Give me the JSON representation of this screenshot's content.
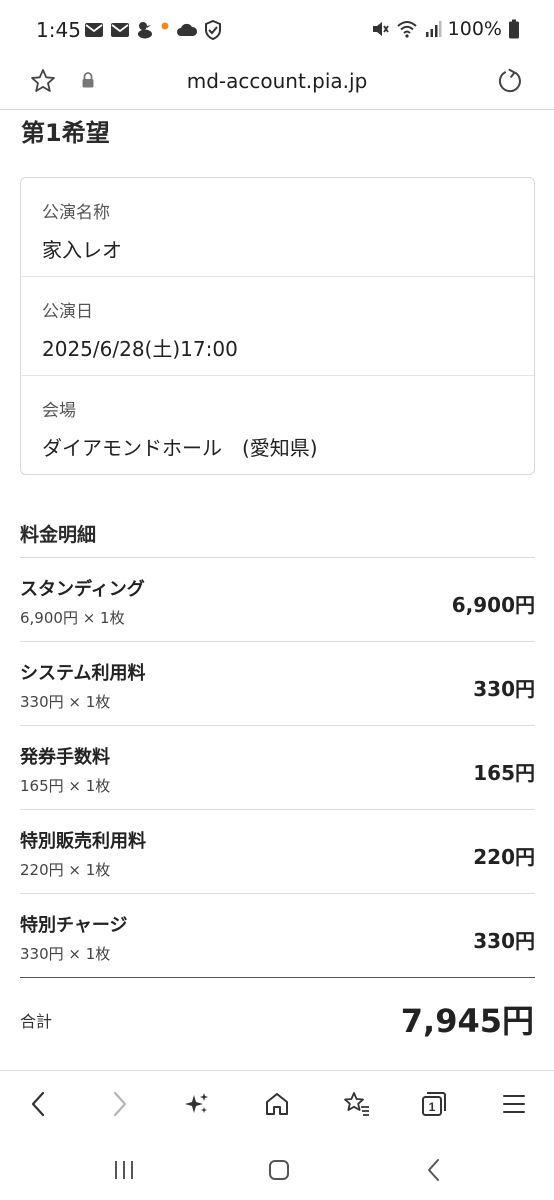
{
  "status_bar": {
    "time": "1:45",
    "battery": "100%",
    "left_icons": [
      "mail-icon",
      "mail-icon",
      "duck-icon",
      "orange-dot-icon",
      "cloud-icon",
      "shield-check-icon"
    ],
    "right_icons": [
      "mute-icon",
      "wifi-icon",
      "signal-icon",
      "battery-icon"
    ]
  },
  "browser": {
    "url": "md-account.pia.jp"
  },
  "choice_title": "第1希望",
  "info": {
    "performance_name_label": "公演名称",
    "performance_name": "家入レオ",
    "performance_date_label": "公演日",
    "performance_date": "2025/6/28(土)17:00",
    "venue_label": "会場",
    "venue": "ダイアモンドホール　(愛知県)"
  },
  "fees": {
    "heading": "料金明細",
    "items": [
      {
        "name": "スタンディング",
        "detail": "6,900円 × 1枚",
        "amount": "6,900円"
      },
      {
        "name": "システム利用料",
        "detail": "330円 × 1枚",
        "amount": "330円"
      },
      {
        "name": "発券手数料",
        "detail": "165円 × 1枚",
        "amount": "165円"
      },
      {
        "name": "特別販売利用料",
        "detail": "220円 × 1枚",
        "amount": "220円"
      },
      {
        "name": "特別チャージ",
        "detail": "330円 × 1枚",
        "amount": "330円"
      }
    ],
    "total_label": "合計",
    "total_amount": "7,945円"
  },
  "toolbar_icons": [
    "back-icon",
    "forward-icon",
    "sparkle-icon",
    "home-icon",
    "bookmarks-icon",
    "tabs-icon",
    "menu-icon"
  ],
  "tab_count": "1",
  "colors": {
    "text": "#222222",
    "muted": "#555555",
    "border": "#d9d9d9",
    "forward_disabled": "#b5b5b5"
  }
}
